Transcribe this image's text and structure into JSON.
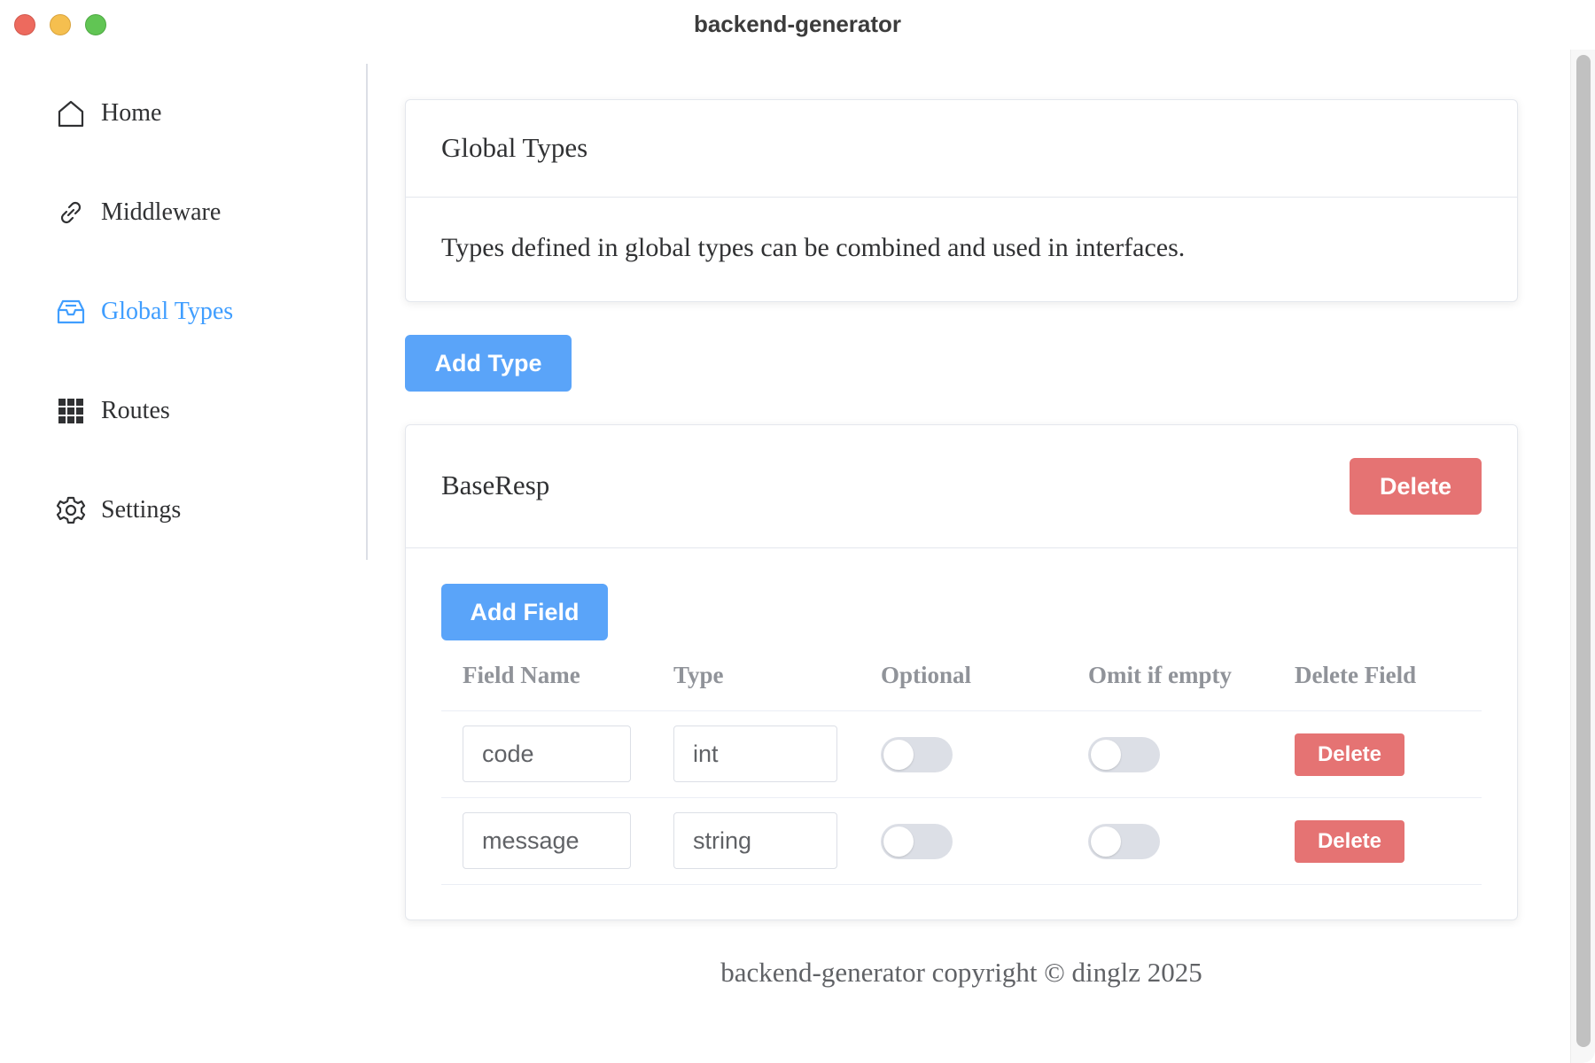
{
  "window": {
    "title": "backend-generator"
  },
  "sidebar": {
    "items": [
      {
        "label": "Home",
        "icon": "home-icon",
        "active": false
      },
      {
        "label": "Middleware",
        "icon": "link-icon",
        "active": false
      },
      {
        "label": "Global Types",
        "icon": "inbox-icon",
        "active": true
      },
      {
        "label": "Routes",
        "icon": "grid-icon",
        "active": false
      },
      {
        "label": "Settings",
        "icon": "gear-icon",
        "active": false
      }
    ]
  },
  "info_card": {
    "title": "Global Types",
    "description": "Types defined in global types can be combined and used in interfaces."
  },
  "add_type_label": "Add Type",
  "type_card": {
    "name": "BaseResp",
    "delete_label": "Delete",
    "add_field_label": "Add Field",
    "columns": [
      "Field Name",
      "Type",
      "Optional",
      "Omit if empty",
      "Delete Field"
    ],
    "fields": [
      {
        "name": "code",
        "type": "int",
        "optional": false,
        "omit_if_empty": false,
        "delete_label": "Delete"
      },
      {
        "name": "message",
        "type": "string",
        "optional": false,
        "omit_if_empty": false,
        "delete_label": "Delete"
      }
    ]
  },
  "footer": {
    "text": "backend-generator copyright © dinglz 2025"
  },
  "colors": {
    "primary": "#5aa4f9",
    "danger": "#e57373",
    "active_nav": "#409eff"
  }
}
